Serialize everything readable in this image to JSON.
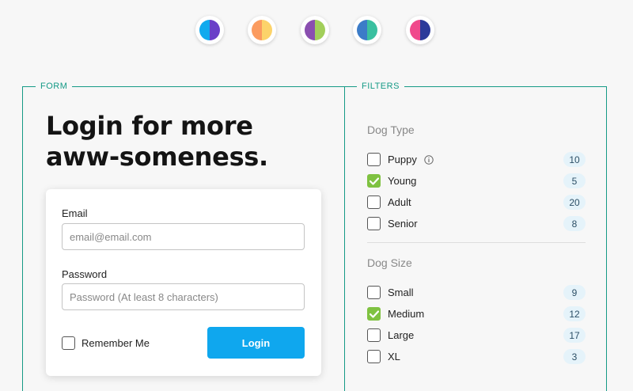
{
  "themes": [
    {
      "name": "blue-purple",
      "left": "#11aaee",
      "right": "#6a3fc8"
    },
    {
      "name": "orange-yellow",
      "left": "#fb9b5f",
      "right": "#fcd36a"
    },
    {
      "name": "purple-green",
      "left": "#8a4fb0",
      "right": "#a2cf5a"
    },
    {
      "name": "blue-teal",
      "left": "#3c7cc8",
      "right": "#3ac0a0"
    },
    {
      "name": "pink-navy",
      "left": "#f04a8c",
      "right": "#2c3a9a"
    }
  ],
  "colors": {
    "accent": "#159a86",
    "button": "#0fa7ee",
    "check": "#7fc241",
    "badge_bg": "#e5f3fa"
  },
  "form": {
    "legend": "FORM",
    "title": "Login for more aww-someness.",
    "email_label": "Email",
    "email_placeholder": "email@email.com",
    "password_label": "Password",
    "password_placeholder": "Password (At least 8 characters)",
    "remember_label": "Remember Me",
    "login_label": "Login"
  },
  "filters": {
    "legend": "FILTERS",
    "dog_type": {
      "title": "Dog Type",
      "options": [
        {
          "label": "Puppy",
          "count": "10",
          "checked": false,
          "info": true
        },
        {
          "label": "Young",
          "count": "5",
          "checked": true,
          "info": false
        },
        {
          "label": "Adult",
          "count": "20",
          "checked": false,
          "info": false
        },
        {
          "label": "Senior",
          "count": "8",
          "checked": false,
          "info": false
        }
      ]
    },
    "dog_size": {
      "title": "Dog Size",
      "options": [
        {
          "label": "Small",
          "count": "9",
          "checked": false
        },
        {
          "label": "Medium",
          "count": "12",
          "checked": true
        },
        {
          "label": "Large",
          "count": "17",
          "checked": false
        },
        {
          "label": "XL",
          "count": "3",
          "checked": false
        }
      ]
    }
  }
}
